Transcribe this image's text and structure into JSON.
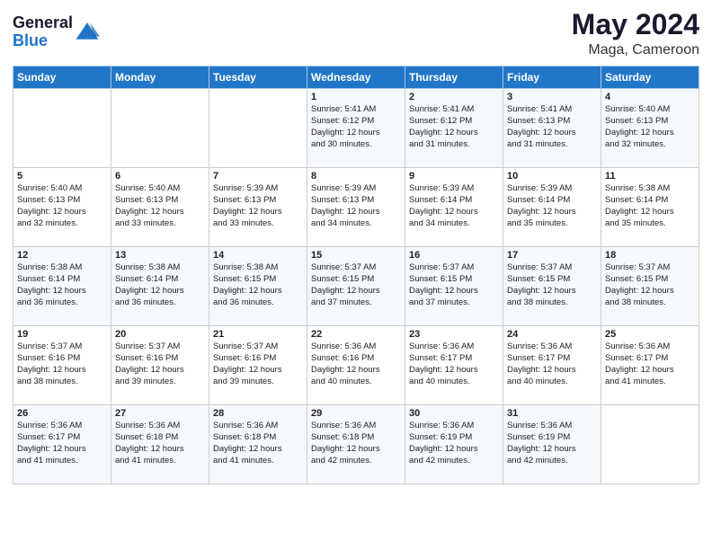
{
  "logo": {
    "line1": "General",
    "line2": "Blue"
  },
  "title": "May 2024",
  "subtitle": "Maga, Cameroon",
  "days_header": [
    "Sunday",
    "Monday",
    "Tuesday",
    "Wednesday",
    "Thursday",
    "Friday",
    "Saturday"
  ],
  "weeks": [
    [
      {
        "num": "",
        "info": ""
      },
      {
        "num": "",
        "info": ""
      },
      {
        "num": "",
        "info": ""
      },
      {
        "num": "1",
        "info": "Sunrise: 5:41 AM\nSunset: 6:12 PM\nDaylight: 12 hours\nand 30 minutes."
      },
      {
        "num": "2",
        "info": "Sunrise: 5:41 AM\nSunset: 6:12 PM\nDaylight: 12 hours\nand 31 minutes."
      },
      {
        "num": "3",
        "info": "Sunrise: 5:41 AM\nSunset: 6:13 PM\nDaylight: 12 hours\nand 31 minutes."
      },
      {
        "num": "4",
        "info": "Sunrise: 5:40 AM\nSunset: 6:13 PM\nDaylight: 12 hours\nand 32 minutes."
      }
    ],
    [
      {
        "num": "5",
        "info": "Sunrise: 5:40 AM\nSunset: 6:13 PM\nDaylight: 12 hours\nand 32 minutes."
      },
      {
        "num": "6",
        "info": "Sunrise: 5:40 AM\nSunset: 6:13 PM\nDaylight: 12 hours\nand 33 minutes."
      },
      {
        "num": "7",
        "info": "Sunrise: 5:39 AM\nSunset: 6:13 PM\nDaylight: 12 hours\nand 33 minutes."
      },
      {
        "num": "8",
        "info": "Sunrise: 5:39 AM\nSunset: 6:13 PM\nDaylight: 12 hours\nand 34 minutes."
      },
      {
        "num": "9",
        "info": "Sunrise: 5:39 AM\nSunset: 6:14 PM\nDaylight: 12 hours\nand 34 minutes."
      },
      {
        "num": "10",
        "info": "Sunrise: 5:39 AM\nSunset: 6:14 PM\nDaylight: 12 hours\nand 35 minutes."
      },
      {
        "num": "11",
        "info": "Sunrise: 5:38 AM\nSunset: 6:14 PM\nDaylight: 12 hours\nand 35 minutes."
      }
    ],
    [
      {
        "num": "12",
        "info": "Sunrise: 5:38 AM\nSunset: 6:14 PM\nDaylight: 12 hours\nand 36 minutes."
      },
      {
        "num": "13",
        "info": "Sunrise: 5:38 AM\nSunset: 6:14 PM\nDaylight: 12 hours\nand 36 minutes."
      },
      {
        "num": "14",
        "info": "Sunrise: 5:38 AM\nSunset: 6:15 PM\nDaylight: 12 hours\nand 36 minutes."
      },
      {
        "num": "15",
        "info": "Sunrise: 5:37 AM\nSunset: 6:15 PM\nDaylight: 12 hours\nand 37 minutes."
      },
      {
        "num": "16",
        "info": "Sunrise: 5:37 AM\nSunset: 6:15 PM\nDaylight: 12 hours\nand 37 minutes."
      },
      {
        "num": "17",
        "info": "Sunrise: 5:37 AM\nSunset: 6:15 PM\nDaylight: 12 hours\nand 38 minutes."
      },
      {
        "num": "18",
        "info": "Sunrise: 5:37 AM\nSunset: 6:15 PM\nDaylight: 12 hours\nand 38 minutes."
      }
    ],
    [
      {
        "num": "19",
        "info": "Sunrise: 5:37 AM\nSunset: 6:16 PM\nDaylight: 12 hours\nand 38 minutes."
      },
      {
        "num": "20",
        "info": "Sunrise: 5:37 AM\nSunset: 6:16 PM\nDaylight: 12 hours\nand 39 minutes."
      },
      {
        "num": "21",
        "info": "Sunrise: 5:37 AM\nSunset: 6:16 PM\nDaylight: 12 hours\nand 39 minutes."
      },
      {
        "num": "22",
        "info": "Sunrise: 5:36 AM\nSunset: 6:16 PM\nDaylight: 12 hours\nand 40 minutes."
      },
      {
        "num": "23",
        "info": "Sunrise: 5:36 AM\nSunset: 6:17 PM\nDaylight: 12 hours\nand 40 minutes."
      },
      {
        "num": "24",
        "info": "Sunrise: 5:36 AM\nSunset: 6:17 PM\nDaylight: 12 hours\nand 40 minutes."
      },
      {
        "num": "25",
        "info": "Sunrise: 5:36 AM\nSunset: 6:17 PM\nDaylight: 12 hours\nand 41 minutes."
      }
    ],
    [
      {
        "num": "26",
        "info": "Sunrise: 5:36 AM\nSunset: 6:17 PM\nDaylight: 12 hours\nand 41 minutes."
      },
      {
        "num": "27",
        "info": "Sunrise: 5:36 AM\nSunset: 6:18 PM\nDaylight: 12 hours\nand 41 minutes."
      },
      {
        "num": "28",
        "info": "Sunrise: 5:36 AM\nSunset: 6:18 PM\nDaylight: 12 hours\nand 41 minutes."
      },
      {
        "num": "29",
        "info": "Sunrise: 5:36 AM\nSunset: 6:18 PM\nDaylight: 12 hours\nand 42 minutes."
      },
      {
        "num": "30",
        "info": "Sunrise: 5:36 AM\nSunset: 6:19 PM\nDaylight: 12 hours\nand 42 minutes."
      },
      {
        "num": "31",
        "info": "Sunrise: 5:36 AM\nSunset: 6:19 PM\nDaylight: 12 hours\nand 42 minutes."
      },
      {
        "num": "",
        "info": ""
      }
    ]
  ]
}
